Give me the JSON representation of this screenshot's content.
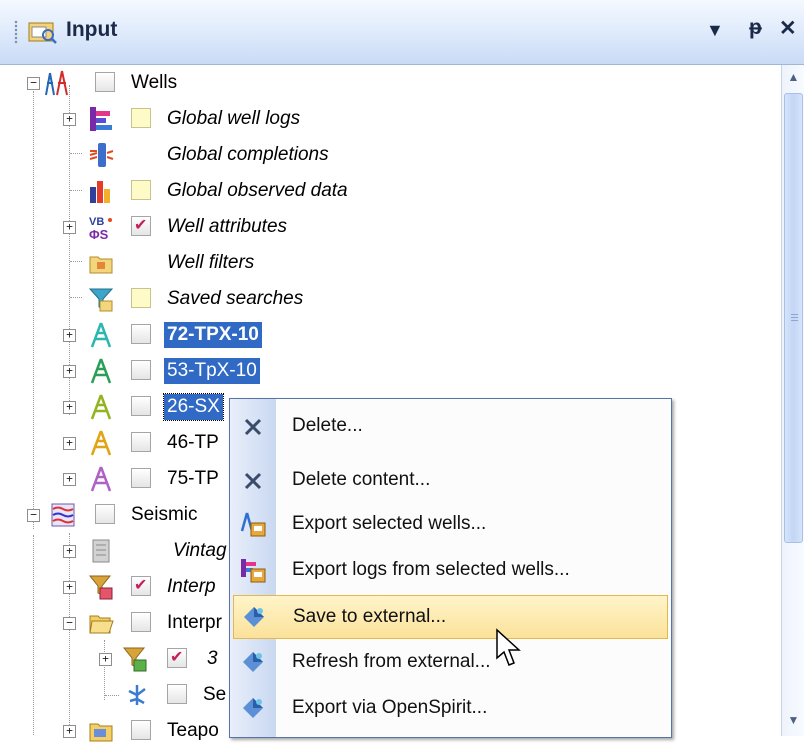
{
  "panel": {
    "title": "Input",
    "buttons": {
      "dropdown": "▾",
      "pin": "ᵖ",
      "close": "✕"
    }
  },
  "tree": {
    "wells": "Wells",
    "global_well_logs": "Global well logs",
    "global_completions": "Global completions",
    "global_observed_data": "Global observed data",
    "well_attributes": "Well attributes",
    "well_filters": "Well filters",
    "saved_searches": "Saved searches",
    "well_1": "72-TPX-10",
    "well_2": "53-TpX-10",
    "well_3": "26-SX",
    "well_4": "46-TP",
    "well_5": "75-TP",
    "seismic": "Seismic",
    "vintag": "Vintag",
    "interp_1": "Interp",
    "interp_2": "Interpr",
    "item_3": "3",
    "item_se": "Se",
    "teapot": "Teapo"
  },
  "context_menu": {
    "items": [
      {
        "label": "Delete...",
        "icon": "delete-x-icon"
      },
      {
        "label": "Delete content...",
        "icon": "delete-x-icon"
      },
      {
        "label": "Export selected wells...",
        "icon": "export-wells-icon"
      },
      {
        "label": "Export logs from selected wells...",
        "icon": "export-logs-icon"
      },
      {
        "label": "Save to external...",
        "icon": "openspirit-icon",
        "highlighted": true
      },
      {
        "label": "Refresh from external...",
        "icon": "openspirit-icon"
      },
      {
        "label": "Export via OpenSpirit...",
        "icon": "openspirit-icon"
      }
    ]
  },
  "colors": {
    "selection": "#316ac5",
    "menu_hover": "#fbe29a",
    "titlebar": "#dde9fb"
  }
}
